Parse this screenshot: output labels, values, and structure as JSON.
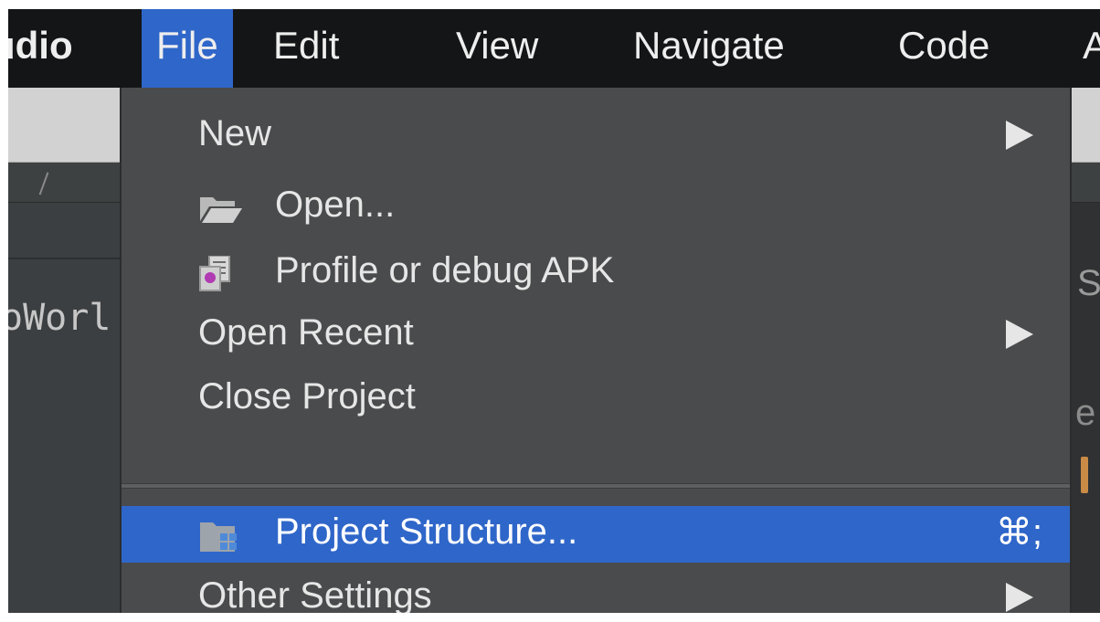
{
  "menubar": {
    "app_name": "udio",
    "items": [
      "File",
      "Edit",
      "View",
      "Navigate",
      "Code",
      "A"
    ]
  },
  "background": {
    "left_text": "oWorl",
    "right_char_1": "S",
    "right_char_2": "e"
  },
  "file_menu": {
    "items": [
      {
        "label": "New",
        "submenu": true
      },
      {
        "label": "Open...",
        "icon": "folder-icon"
      },
      {
        "label": "Profile or debug APK",
        "icon": "apk-icon"
      },
      {
        "label": "Open Recent",
        "submenu": true
      },
      {
        "label": "Close Project"
      },
      {
        "label": "Project Structure...",
        "icon": "project-structure-icon",
        "shortcut": "⌘;",
        "selected": true
      },
      {
        "label": "Other Settings",
        "submenu": true
      }
    ]
  },
  "colors": {
    "menubar_bg": "#141517",
    "menu_bg": "#4a4b4c",
    "selection": "#2f66c9",
    "text": "#e6e6e6"
  }
}
